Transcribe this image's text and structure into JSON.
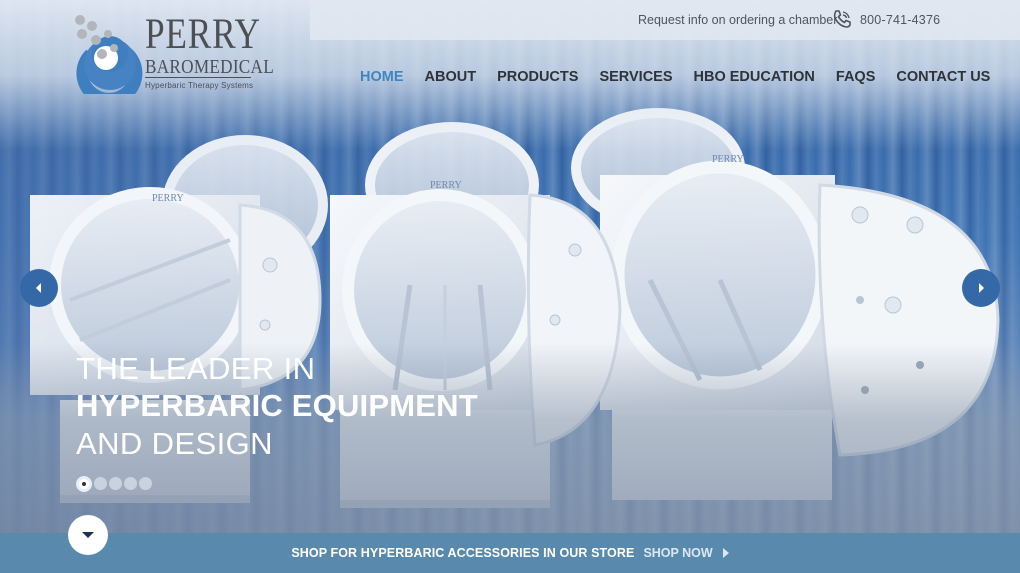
{
  "brand": {
    "name": "PERRY",
    "subname": "BAROMEDICAL",
    "tagline": "Hyperbaric Therapy Systems"
  },
  "topbar": {
    "request_text": "Request info on ordering a chamber",
    "phone": "800-741-4376"
  },
  "nav": {
    "items": [
      {
        "label": "HOME",
        "active": true
      },
      {
        "label": "ABOUT"
      },
      {
        "label": "PRODUCTS"
      },
      {
        "label": "SERVICES"
      },
      {
        "label": "HBO EDUCATION"
      },
      {
        "label": "FAQS"
      },
      {
        "label": "CONTACT US"
      }
    ]
  },
  "hero": {
    "line1": "THE LEADER IN",
    "line2": "HYPERBARIC EQUIPMENT",
    "line3": "AND DESIGN",
    "chamber_label": "PERRY",
    "slide_count": 5,
    "active_slide": 1
  },
  "shopbar": {
    "text": "SHOP FOR HYPERBARIC ACCESSORIES IN OUR STORE",
    "link": "SHOP NOW"
  },
  "colors": {
    "accent": "#3f86be",
    "nav_text": "#2f3338",
    "shopbar_bg": "#5a89ae",
    "arrow_bg": "#3568a6"
  }
}
